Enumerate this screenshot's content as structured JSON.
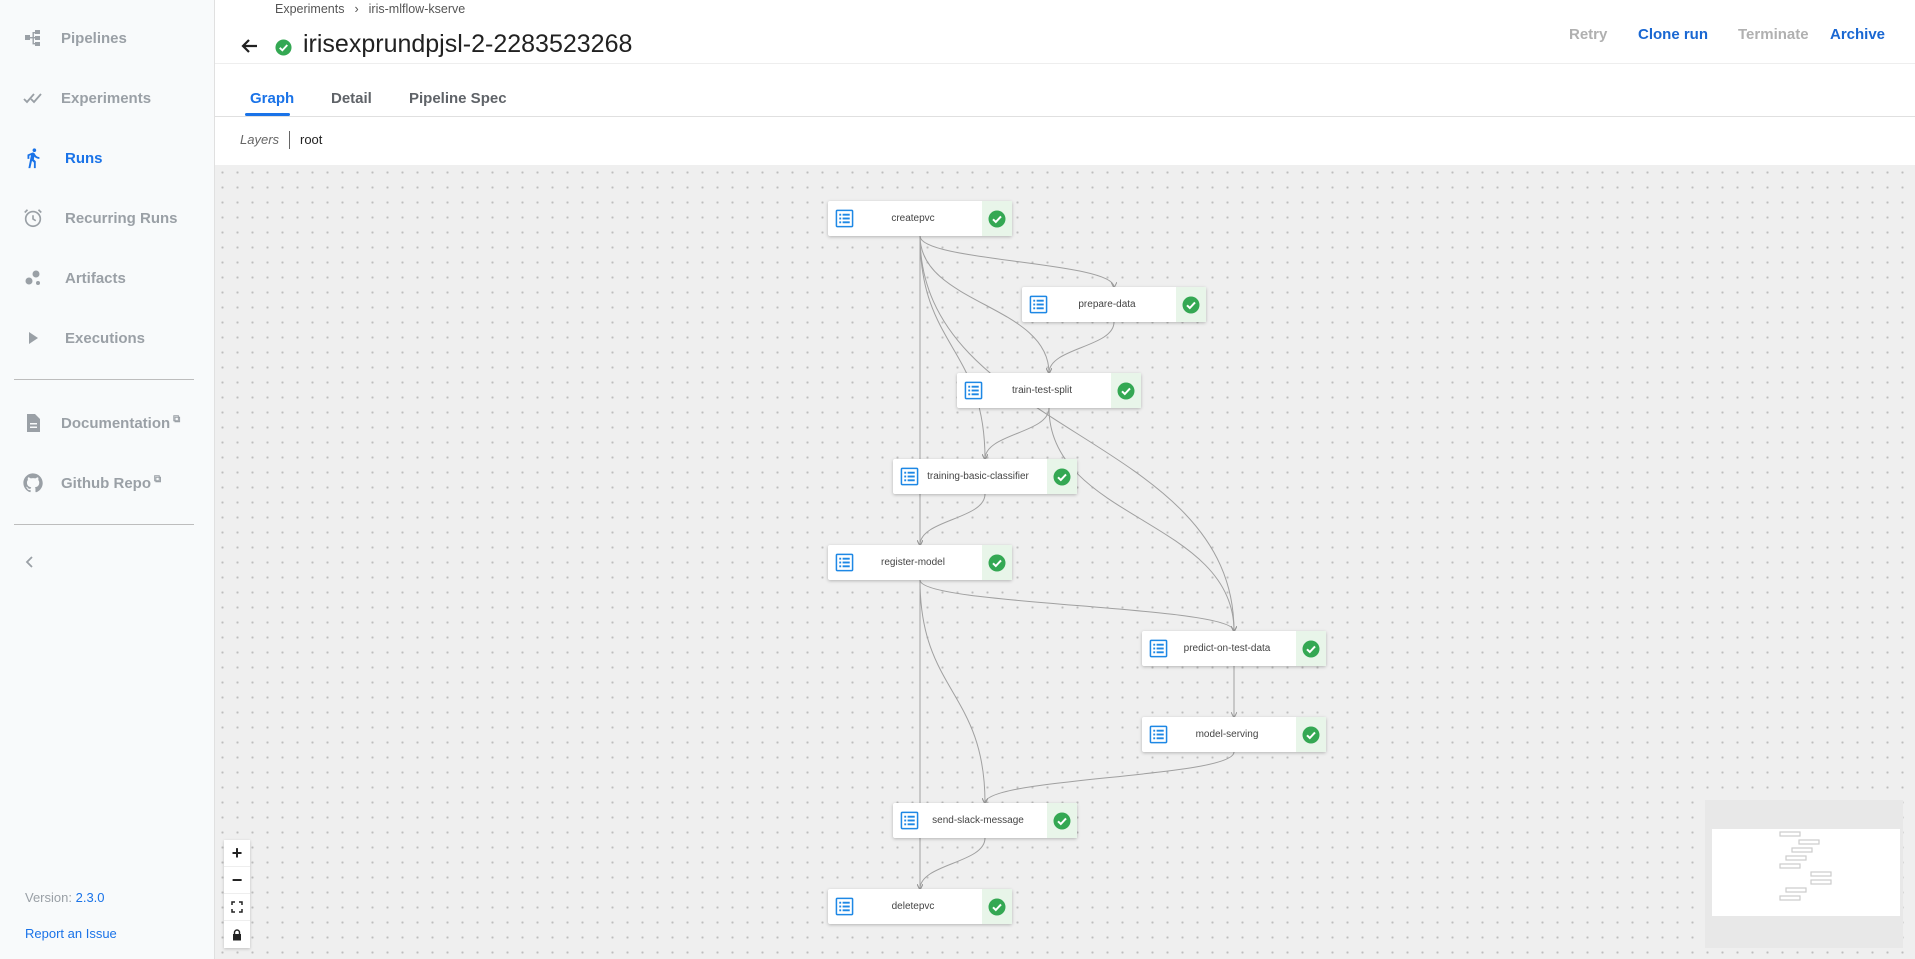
{
  "sidebar": {
    "items": [
      {
        "label": "Pipelines",
        "icon": "pipelines-icon"
      },
      {
        "label": "Experiments",
        "icon": "experiments-icon"
      },
      {
        "label": "Runs",
        "icon": "runs-icon"
      },
      {
        "label": "Recurring Runs",
        "icon": "alarm-clock-icon"
      },
      {
        "label": "Artifacts",
        "icon": "artifacts-icon"
      },
      {
        "label": "Executions",
        "icon": "play-icon"
      }
    ],
    "active": "Runs",
    "external_links": [
      {
        "label": "Documentation",
        "icon": "document-icon"
      },
      {
        "label": "Github Repo",
        "icon": "github-icon"
      }
    ],
    "external_mark": "⧉",
    "version_label": "Version:",
    "version": "2.3.0",
    "report_issue": "Report an Issue"
  },
  "header": {
    "breadcrumb": [
      "Experiments",
      "iris-mlflow-kserve"
    ],
    "breadcrumb_sep": "›",
    "title": "irisexprundpjsl-2-2283523268",
    "status": "succeeded",
    "actions": {
      "retry": "Retry",
      "clone": "Clone run",
      "terminate": "Terminate",
      "archive": "Archive"
    }
  },
  "tabs": {
    "graph": "Graph",
    "detail": "Detail",
    "spec": "Pipeline Spec",
    "active": "Graph"
  },
  "layers": {
    "label": "Layers",
    "value": "root"
  },
  "graph": {
    "nodes": [
      {
        "id": "createpvc",
        "label": "createpvc",
        "status": "succeeded"
      },
      {
        "id": "prepare-data",
        "label": "prepare-data",
        "status": "succeeded"
      },
      {
        "id": "train-test-split",
        "label": "train-test-split",
        "status": "succeeded"
      },
      {
        "id": "training-basic-classifier",
        "label": "training-basic-classifier",
        "status": "succeeded"
      },
      {
        "id": "register-model",
        "label": "register-model",
        "status": "succeeded"
      },
      {
        "id": "predict-on-test-data",
        "label": "predict-on-test-data",
        "status": "succeeded"
      },
      {
        "id": "model-serving",
        "label": "model-serving",
        "status": "succeeded"
      },
      {
        "id": "send-slack-message",
        "label": "send-slack-message",
        "status": "succeeded"
      },
      {
        "id": "deletepvc",
        "label": "deletepvc",
        "status": "succeeded"
      }
    ],
    "edges": [
      [
        "createpvc",
        "prepare-data"
      ],
      [
        "createpvc",
        "train-test-split"
      ],
      [
        "createpvc",
        "training-basic-classifier"
      ],
      [
        "createpvc",
        "register-model"
      ],
      [
        "createpvc",
        "predict-on-test-data"
      ],
      [
        "createpvc",
        "deletepvc"
      ],
      [
        "prepare-data",
        "train-test-split"
      ],
      [
        "train-test-split",
        "training-basic-classifier"
      ],
      [
        "train-test-split",
        "predict-on-test-data"
      ],
      [
        "training-basic-classifier",
        "register-model"
      ],
      [
        "register-model",
        "predict-on-test-data"
      ],
      [
        "register-model",
        "send-slack-message"
      ],
      [
        "predict-on-test-data",
        "model-serving"
      ],
      [
        "model-serving",
        "send-slack-message"
      ],
      [
        "send-slack-message",
        "deletepvc"
      ]
    ]
  },
  "zoom": {
    "in": "+",
    "out": "−"
  },
  "colors": {
    "accent": "#1a73e8",
    "success": "#34a853",
    "node_icon": "#1e88e5"
  }
}
